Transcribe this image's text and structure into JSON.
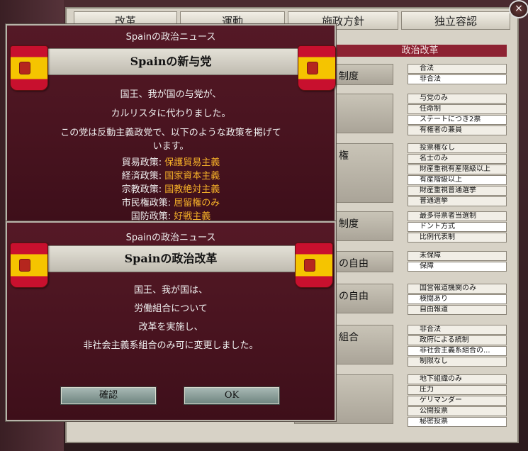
{
  "tabs": [
    "改革",
    "運動",
    "施政方針",
    "独立容認"
  ],
  "close_label": "×",
  "political_reforms": {
    "header": "政治改革",
    "issues": [
      {
        "name": "制度",
        "options": [
          {
            "label": "合法",
            "selected": false
          },
          {
            "label": "非合法",
            "selected": true
          }
        ]
      },
      {
        "name": "",
        "options": [
          {
            "label": "与党のみ",
            "selected": false
          },
          {
            "label": "任命制",
            "selected": false
          },
          {
            "label": "ステートにつき2票",
            "selected": true
          },
          {
            "label": "有権者の兼員",
            "selected": false
          }
        ]
      },
      {
        "name": "権",
        "options": [
          {
            "label": "投票権なし",
            "selected": false
          },
          {
            "label": "名士のみ",
            "selected": false
          },
          {
            "label": "財産重視有産階級以上",
            "selected": false
          },
          {
            "label": "有産階級以上",
            "selected": true
          },
          {
            "label": "財産重視普通選挙",
            "selected": false
          },
          {
            "label": "普通選挙",
            "selected": false
          }
        ]
      },
      {
        "name": "制度",
        "options": [
          {
            "label": "最多得票者当選制",
            "selected": false
          },
          {
            "label": "ドント方式",
            "selected": true
          },
          {
            "label": "比例代表制",
            "selected": false
          }
        ]
      },
      {
        "name": "の自由",
        "options": [
          {
            "label": "未保障",
            "selected": false
          },
          {
            "label": "保障",
            "selected": true
          }
        ]
      },
      {
        "name": "の自由",
        "options": [
          {
            "label": "国営報道機関のみ",
            "selected": false
          },
          {
            "label": "検閲あり",
            "selected": true
          },
          {
            "label": "自由報道",
            "selected": false
          }
        ]
      },
      {
        "name": "組合",
        "options": [
          {
            "label": "非合法",
            "selected": false
          },
          {
            "label": "政府による統制",
            "selected": false
          },
          {
            "label": "非社会主義系組合の...",
            "selected": true
          },
          {
            "label": "制限なし",
            "selected": false
          }
        ]
      },
      {
        "name": "",
        "options": [
          {
            "label": "地下組織のみ",
            "selected": false
          },
          {
            "label": "圧力",
            "selected": false
          },
          {
            "label": "ゲリマンダー",
            "selected": false
          },
          {
            "label": "公開投票",
            "selected": false
          },
          {
            "label": "秘密投票",
            "selected": true
          }
        ]
      }
    ]
  },
  "popup1": {
    "title": "Spainの政治ニュース",
    "headline": "Spainの新与党",
    "lines": [
      "国王、我が国の与党が、",
      "カルリスタに代わりました。",
      "この党は反動主義政党で、以下のような政策を掲げて",
      "います。"
    ],
    "policies": [
      {
        "label": "貿易政策: ",
        "value": "保護貿易主義"
      },
      {
        "label": "経済政策: ",
        "value": "国家資本主義"
      },
      {
        "label": "宗教政策: ",
        "value": "国教絶対主義"
      },
      {
        "label": "市民権政策: ",
        "value": "居留権のみ"
      },
      {
        "label": "国防政策: ",
        "value": "好戦主義"
      }
    ]
  },
  "popup2": {
    "title": "Spainの政治ニュース",
    "headline": "Spainの政治改革",
    "lines": [
      "国王、我が国は、",
      "労働組合について",
      "改革を実施し、",
      "非社会主義系組合のみ可に変更しました。"
    ],
    "confirm_label": "確認",
    "ok_label": "OK"
  },
  "colors": {
    "accent": "#f5b028",
    "popup_bg": "#4a1420",
    "header_red": "#8d2232"
  }
}
